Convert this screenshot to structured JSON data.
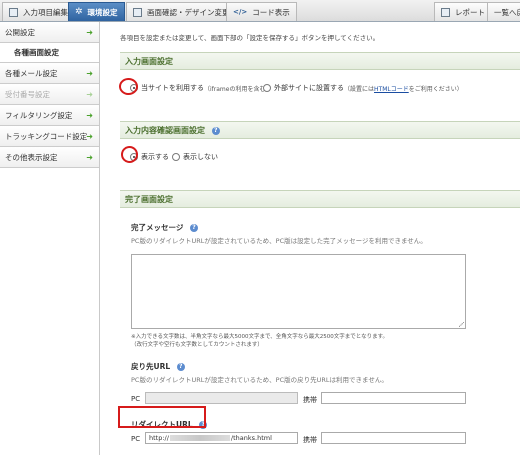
{
  "tabs": [
    {
      "label": "入力項目編集",
      "active": false
    },
    {
      "label": "環境設定",
      "active": true
    },
    {
      "label": "画面確認・デザイン変更",
      "active": false
    },
    {
      "label": "コード表示",
      "active": false
    }
  ],
  "right_tabs": {
    "report": "レポート",
    "list": "一覧へ戻"
  },
  "sidebar": {
    "items": [
      {
        "label": "公開設定",
        "state": "normal"
      },
      {
        "label": "各種画面設定",
        "state": "selected"
      },
      {
        "label": "各種メール設定",
        "state": "normal"
      },
      {
        "label": "受付番号設定",
        "state": "disabled"
      },
      {
        "label": "フィルタリング設定",
        "state": "normal"
      },
      {
        "label": "トラッキングコード設定",
        "state": "normal"
      },
      {
        "label": "その他表示設定",
        "state": "normal"
      }
    ]
  },
  "main": {
    "intro": "各項目を設定または変更して、画面下部の「設定を保存する」ボタンを押してください。",
    "input_screen": {
      "heading": "入力画面設定",
      "option1": "当サイトを利用する",
      "option1_sub": "（iframeの利用を含む）",
      "option2": "外部サイトに設置する",
      "option2_sub_before": "（設置には",
      "option2_link": "HTMLコード",
      "option2_sub_after": "をご利用ください）",
      "selected": "option1"
    },
    "confirm_screen": {
      "heading": "入力内容確認画面設定",
      "option1": "表示する",
      "option2": "表示しない",
      "selected": "option1"
    },
    "complete_screen": {
      "heading": "完了画面設定",
      "message_label": "完了メッセージ",
      "message_note": "PC版のリダイレクトURLが設定されているため、PC版は設定した完了メッセージを利用できません。",
      "message_value": "",
      "limit_note_line1": "※入力できる文字数は、半角文字なら最大5000文字まで、全角文字なら最大2500文字までとなります。",
      "limit_note_line2": "（改行文字や空行も文字数としてカウントされます）",
      "return_url_label": "戻り先URL",
      "return_url_note": "PC版のリダイレクトURLが設定されているため、PC版の戻り先URLは利用できません。",
      "pc_label": "PC",
      "mobile_label": "携帯",
      "return_pc_value": "",
      "return_mobile_value": "",
      "redirect_label": "リダイレクトURL",
      "redirect_pc_prefix": "http://",
      "redirect_pc_suffix": "/thanks.html",
      "redirect_mobile_value": ""
    }
  }
}
